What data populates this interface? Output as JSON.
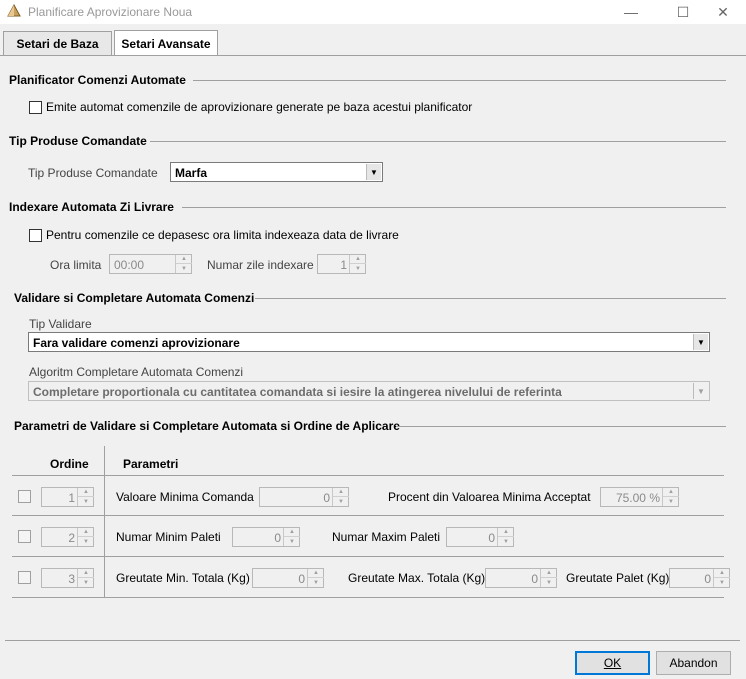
{
  "window": {
    "title": "Planificare Aprovizionare Noua",
    "minimize_glyph": "—",
    "maximize_glyph": "☐",
    "close_glyph": "✕"
  },
  "tabs": [
    {
      "label": "Setari de Baza",
      "active": false
    },
    {
      "label": "Setari Avansate",
      "active": true
    }
  ],
  "auto_planner": {
    "title": "Planificator Comenzi Automate",
    "checkbox_label": "Emite automat comenzile de aprovizionare generate pe baza acestui planificator",
    "checked": false
  },
  "product_type": {
    "title": "Tip Produse Comandate",
    "label": "Tip Produse Comandate",
    "value": "Marfa"
  },
  "auto_index": {
    "title": "Indexare Automata Zi Livrare",
    "checkbox_label": "Pentru comenzile ce depasesc ora limita indexeaza data de livrare",
    "checked": false,
    "time_label": "Ora limita",
    "time_value": "00:00",
    "days_label": "Numar zile indexare",
    "days_value": "1"
  },
  "validation": {
    "title": "Validare si Completare Automata Comenzi",
    "type_label": "Tip Validare",
    "type_value": "Fara validare comenzi aprovizionare",
    "algo_label": "Algoritm Completare Automata Comenzi",
    "algo_value": "Completare proportionala cu cantitatea comandata si iesire la atingerea nivelului de referinta"
  },
  "params": {
    "title": "Parametri de Validare si Completare Automata si Ordine de Aplicare",
    "col_order": "Ordine",
    "col_params": "Parametri",
    "rows": [
      {
        "order": "1",
        "p1_label": "Valoare Minima Comanda",
        "p1_value": "0",
        "p2_label": "Procent din Valoarea Minima Acceptat",
        "p2_value": "75.00 %"
      },
      {
        "order": "2",
        "p1_label": "Numar Minim Paleti",
        "p1_value": "0",
        "p2_label": "Numar Maxim Paleti",
        "p2_value": "0"
      },
      {
        "order": "3",
        "p1_label": "Greutate Min. Totala (Kg)",
        "p1_value": "0",
        "p2_label": "Greutate Max. Totala (Kg)",
        "p2_value": "0",
        "p3_label": "Greutate Palet (Kg)",
        "p3_value": "0"
      }
    ]
  },
  "footer": {
    "ok_label": "OK",
    "cancel_label": "Abandon"
  }
}
